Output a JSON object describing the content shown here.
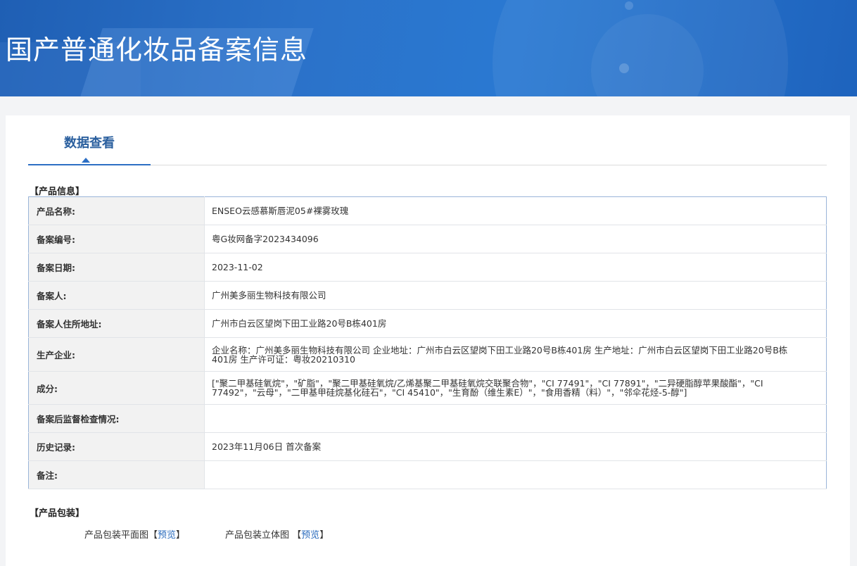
{
  "banner": {
    "title": "国产普通化妆品备案信息"
  },
  "tabs": {
    "active": "数据查看"
  },
  "product_info": {
    "section_title": "【产品信息】",
    "rows": [
      {
        "label": "产品名称:",
        "value": "ENSEO云感慕斯唇泥05#裸雾玫瑰"
      },
      {
        "label": "备案编号:",
        "value": "粤G妆网备字2023434096"
      },
      {
        "label": "备案日期:",
        "value": "2023-11-02"
      },
      {
        "label": "备案人:",
        "value": "广州美多丽生物科技有限公司"
      },
      {
        "label": "备案人住所地址:",
        "value": "广州市白云区望岗下田工业路20号B栋401房"
      },
      {
        "label": "生产企业:",
        "value": "企业名称：广州美多丽生物科技有限公司 企业地址：广州市白云区望岗下田工业路20号B栋401房 生产地址：广州市白云区望岗下田工业路20号B栋401房 生产许可证：粤妆20210310"
      },
      {
        "label": "成分:",
        "value": "[\"聚二甲基硅氧烷\"，\"矿脂\"，\"聚二甲基硅氧烷/乙烯基聚二甲基硅氧烷交联聚合物\"，\"CI 77491\"，\"CI 77891\"，\"二异硬脂醇苹果酸酯\"，\"CI 77492\"，\"云母\"，\"二甲基甲硅烷基化硅石\"，\"CI 45410\"，\"生育酚（维生素E）\"，\"食用香精（料）\"，\"邻伞花烃-5-醇\"]"
      },
      {
        "label": "备案后监督检查情况:",
        "value": ""
      },
      {
        "label": "历史记录:",
        "value": "2023年11月06日 首次备案"
      },
      {
        "label": "备注:",
        "value": ""
      }
    ]
  },
  "packaging": {
    "section_title": "【产品包装】",
    "flat_label": "产品包装平面图",
    "flat_link": "预览",
    "three_d_label": "产品包装立体图",
    "three_d_link": "预览",
    "bracket_open": "【",
    "bracket_close": "】"
  }
}
